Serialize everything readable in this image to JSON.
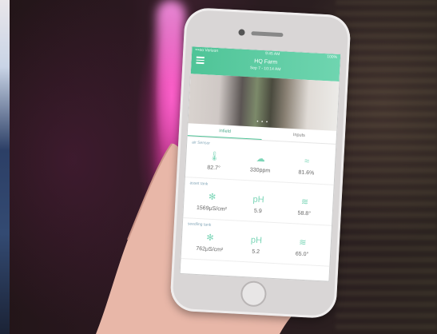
{
  "app": {
    "statusbar": {
      "carrier": "•••oo Verizon",
      "time": "9:45 AM",
      "battery": "100%"
    },
    "title": "HQ Farm",
    "subtitle": "Sep 7 - 10:14 AM",
    "carousel_dots": "• • •",
    "tabs": [
      {
        "label": "Infield"
      },
      {
        "label": "Inputs"
      }
    ],
    "cards": [
      {
        "title": "air Sensor",
        "metrics": [
          {
            "icon": "thermometer-icon",
            "glyph": "🌡",
            "value": "82.7°"
          },
          {
            "icon": "cloud-icon",
            "glyph": "☁",
            "value": "330ppm"
          },
          {
            "icon": "humidity-icon",
            "glyph": "≈",
            "value": "81.6%"
          }
        ]
      },
      {
        "title": "asset tank",
        "metrics": [
          {
            "icon": "fan-icon",
            "glyph": "✻",
            "value": "1569μS/cm²"
          },
          {
            "icon": "ph-icon",
            "glyph": "pH",
            "value": "5.9"
          },
          {
            "icon": "water-temp-icon",
            "glyph": "≋",
            "value": "58.8°"
          }
        ]
      },
      {
        "title": "seedling tank",
        "metrics": [
          {
            "icon": "fan-icon",
            "glyph": "✻",
            "value": "762μS/cm²"
          },
          {
            "icon": "ph-icon",
            "glyph": "pH",
            "value": "5.2"
          },
          {
            "icon": "water-temp-icon",
            "glyph": "≋",
            "value": "65.0°"
          }
        ]
      }
    ]
  }
}
